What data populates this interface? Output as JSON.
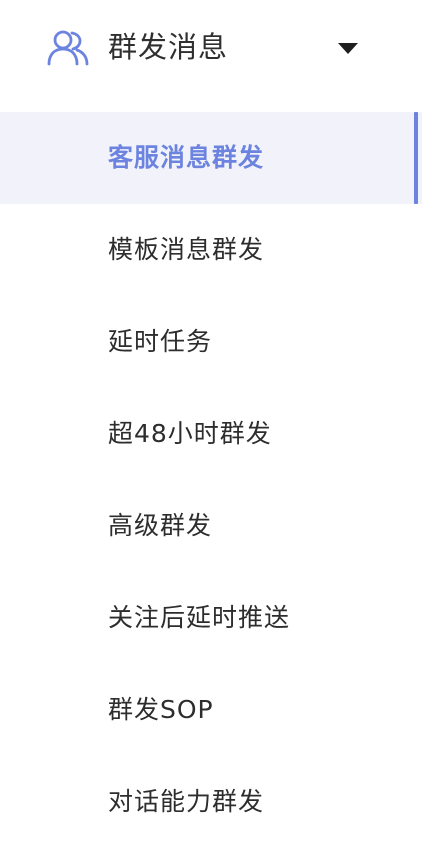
{
  "group": {
    "title": "群发消息",
    "icon": "users-icon",
    "expanded": true,
    "accent_color": "#6c84df"
  },
  "menu": {
    "active_index": 0,
    "items": [
      {
        "label": "客服消息群发"
      },
      {
        "label": "模板消息群发"
      },
      {
        "label": "延时任务"
      },
      {
        "label": "超48小时群发"
      },
      {
        "label": "高级群发"
      },
      {
        "label": "关注后延时推送"
      },
      {
        "label": "群发SOP"
      },
      {
        "label": "对话能力群发"
      }
    ]
  }
}
